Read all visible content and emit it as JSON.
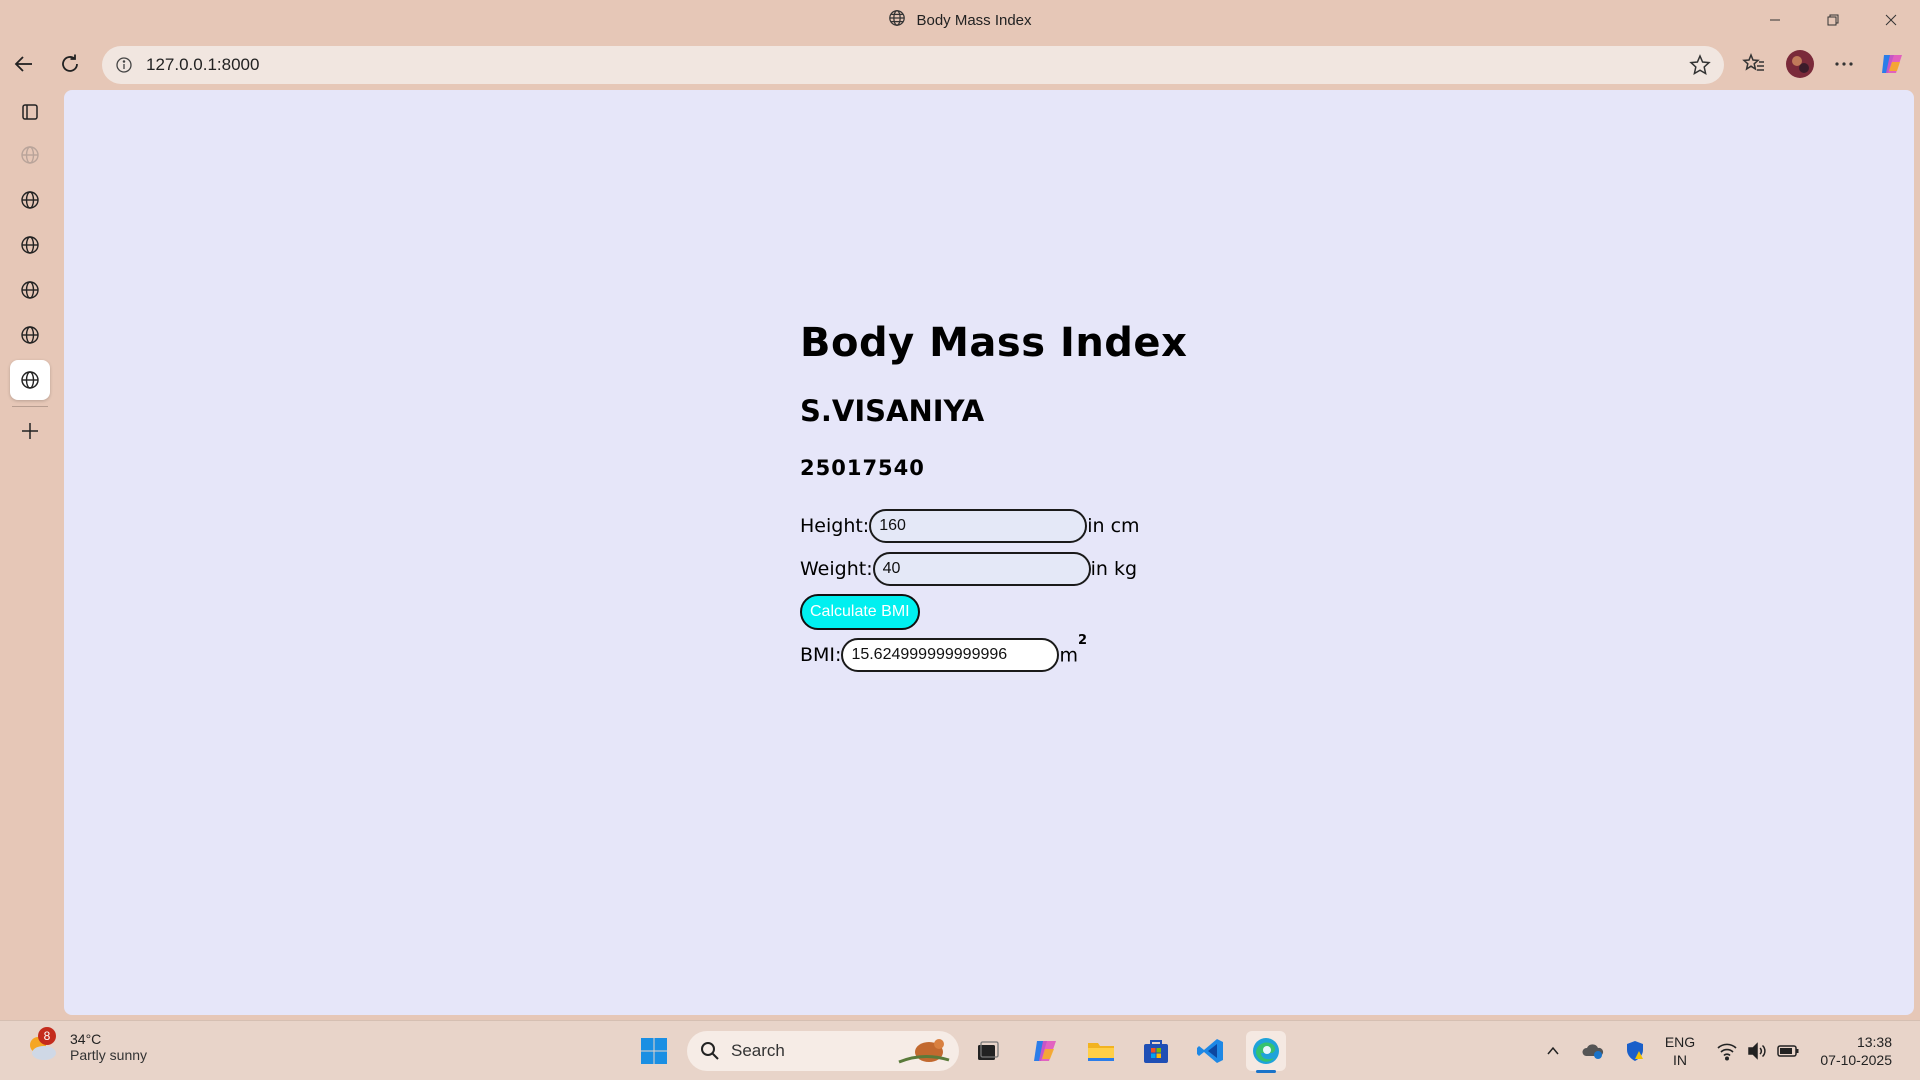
{
  "window": {
    "title": "Body Mass Index"
  },
  "browser": {
    "url": "127.0.0.1:8000"
  },
  "page": {
    "heading": "Body Mass Index",
    "name": "S.VISANIYA",
    "id_number": "25017540",
    "height_label": "Height:",
    "height_value": "160",
    "height_unit": "in cm",
    "weight_label": "Weight:",
    "weight_value": "40",
    "weight_unit": "in kg",
    "calculate_label": "Calculate BMI",
    "bmi_label": "BMI:",
    "bmi_value": "15.624999999999996",
    "bmi_unit": "m",
    "bmi_unit_exp": "2"
  },
  "taskbar": {
    "weather_badge": "8",
    "weather_temp": "34°C",
    "weather_desc": "Partly sunny",
    "search_label": "Search",
    "lang_top": "ENG",
    "lang_bottom": "IN",
    "time": "13:38",
    "date": "07-10-2025"
  },
  "colors": {
    "viewport_bg": "#e6e6f9",
    "chrome_bg": "#e6c7b7",
    "button_bg": "#00f0f0"
  }
}
